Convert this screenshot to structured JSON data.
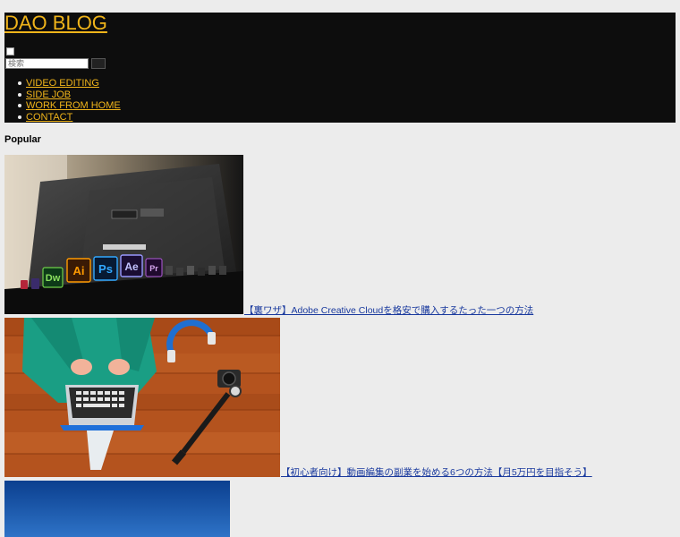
{
  "header": {
    "site_title": "DAO BLOG",
    "search": {
      "placeholder": "検索"
    },
    "nav": [
      {
        "label": "VIDEO EDITING"
      },
      {
        "label": "SIDE JOB"
      },
      {
        "label": "WORK FROM HOME"
      },
      {
        "label": "CONTACT"
      }
    ]
  },
  "popular": {
    "heading": "Popular",
    "posts": [
      {
        "title": "【裏ワザ】Adobe Creative Cloudを格安で購入するたった一つの方法",
        "icons": [
          "Dw",
          "Ai",
          "Ps",
          "Ae",
          "Pr"
        ]
      },
      {
        "title": "【初心者向け】動画編集の副業を始める6つの方法【月5万円を目指そう】"
      },
      {
        "title": ""
      }
    ]
  },
  "colors": {
    "header_bg": "#0d0d0d",
    "accent": "#f0b41a",
    "link": "#1a3a9e",
    "page_bg": "#ececec"
  }
}
